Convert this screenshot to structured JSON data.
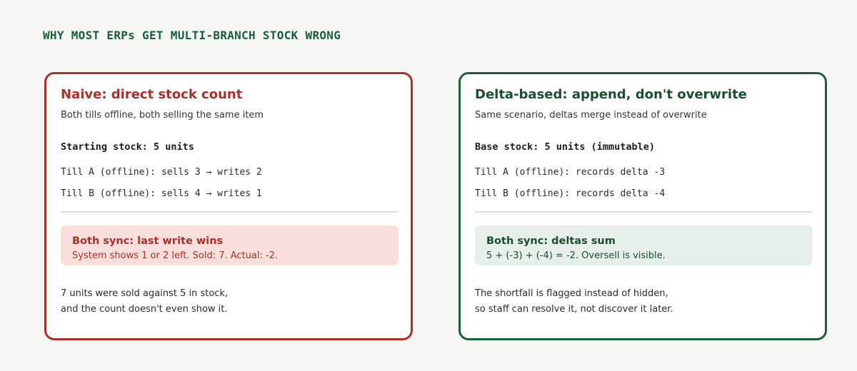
{
  "page_title": "WHY MOST ERPs GET MULTI-BRANCH STOCK WRONG",
  "naive_panel": {
    "title": "Naive: direct stock count",
    "subtitle": "Both tills offline, both selling the same item",
    "starting": "Starting stock: 5 units",
    "till_a": "Till A (offline): sells 3 → writes 2",
    "till_b": "Till B (offline): sells 4 → writes 1",
    "result_title": "Both sync: last write wins",
    "result_detail": "System shows 1 or 2 left. Sold: 7. Actual: -2.",
    "footnote_line1": "7 units were sold against 5 in stock,",
    "footnote_line2": "and the count doesn't even show it.",
    "accent_color": "#a8302a",
    "result_bg": "#f8dfdb"
  },
  "delta_panel": {
    "title": "Delta-based: append, don't overwrite",
    "subtitle": "Same scenario, deltas merge instead of overwrite",
    "starting": "Base stock: 5 units (immutable)",
    "till_a": "Till A (offline): records delta -3",
    "till_b": "Till B (offline): records delta -4",
    "result_title": "Both sync: deltas sum",
    "result_detail": "5 + (-3) + (-4) = -2. Oversell is visible.",
    "footnote_line1": "The shortfall is flagged instead of hidden,",
    "footnote_line2": "so staff can resolve it, not discover it later.",
    "accent_color": "#1b5e3b",
    "result_bg": "#e6efe9"
  }
}
